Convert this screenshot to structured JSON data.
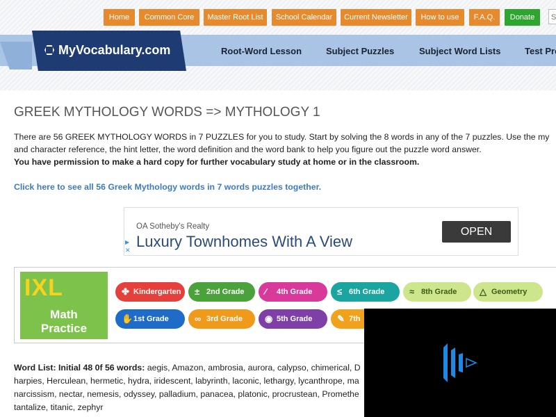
{
  "topnav": {
    "home": "Home",
    "common_core": "Common Core",
    "master_root_list": "Master Root List",
    "school_calendar": "School Calendar",
    "current_newsletter": "Current Newsletter",
    "how_to_use": "How to use",
    "faq": "F.A.Q.",
    "donate": "Donate",
    "search_placeholder": "S"
  },
  "logo": {
    "text": "MyVocabulary.com"
  },
  "mainnav": {
    "root_word_lesson": "Root-Word Lesson",
    "subject_puzzles": "Subject Puzzles",
    "subject_word_lists": "Subject Word Lists",
    "test_prep": "Test Pre"
  },
  "page": {
    "title": "GREEK MYTHOLOGY WORDS => MYTHOLOGY 1",
    "intro_line1": "There are 56 GREEK MYTHOLOGY WORDS in 7 PUZZLES for you to study. Start by solving the 8 words in any of the 7 puzzles. Use the my",
    "intro_line2": "and character reference, the hint letter, the word definition and the word bank to help you figure out the puzzle word answer.",
    "intro_bold": "You have permission to make a hard copy for further vocabulary study at home or in the classroom.",
    "see_all_link": "Click here to see all 56 Greek Mythology words in 7 words puzzles together."
  },
  "ad1": {
    "advertiser": "OA Sotheby's Realty",
    "headline": "Luxury Townhomes With A View",
    "button": "OPEN"
  },
  "ad2": {
    "logo_text": "IXL",
    "subtitle_line1": "Math",
    "subtitle_line2": "Practice",
    "grades": {
      "kindergarten": "Kindergarten",
      "second": "2nd Grade",
      "fourth": "4th Grade",
      "sixth": "6th Grade",
      "eighth": "8th Grade",
      "geometry": "Geometry",
      "first": "1st Grade",
      "third": "3rd Grade",
      "fifth": "5th Grade",
      "seventh": "7th"
    }
  },
  "wordlist": {
    "label": "Word List: Initial 48 0f 56 words:",
    "line1": " aegis, Amazon, ambrosia, aurora, calypso, chimerical, D",
    "line2": "harpies, Herculean, hermetic, hydra, iridescent, labyrinth, laconic, lethargy, lycanthrope, ma",
    "line3": "narcissism, nectar, nemesis, odyssey, palladium, panacea, platonic, procrustean, Promethe",
    "line4": "tantalize, titanic, zephyr"
  },
  "colors": {
    "nav_orange": "#e68a2e",
    "donate_green": "#2ea52e",
    "logo_navy": "#1f3b73",
    "nav_bar_blue": "#a9c4e4",
    "link_blue": "#3d7bbf",
    "video_accent": "#1e88e5"
  }
}
